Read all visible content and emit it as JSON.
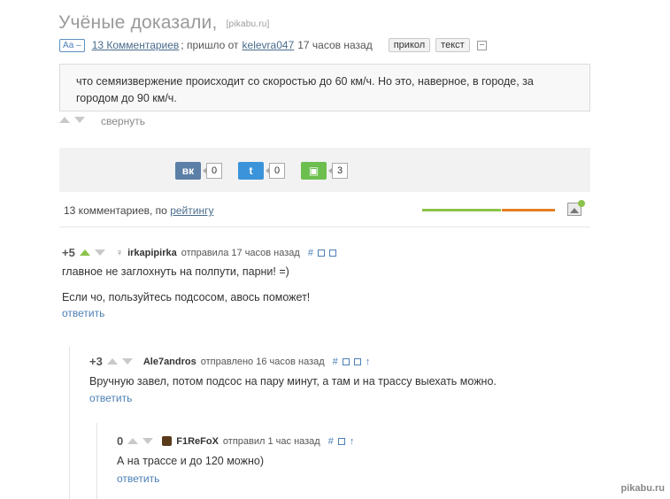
{
  "post": {
    "title": "Учёные доказали,",
    "source": "[pikabu.ru]",
    "font_toggle": "Аа –",
    "comments_link": "13 Комментариев",
    "from_text": "; пришло от",
    "author": "kelevra047",
    "time": "17 часов назад",
    "tags": [
      "прикол",
      "текст"
    ],
    "body": "что семяизвержение происходит со скоростью до 60 км/ч. Но это, наверное, в городе, за городом до 90 км/ч.",
    "collapse_label": "свернуть"
  },
  "share": {
    "vk": {
      "label": "вк",
      "count": "0"
    },
    "twitter": {
      "label": "t",
      "count": "0"
    },
    "save": {
      "label": "▣",
      "count": "3"
    }
  },
  "comments_header": {
    "text": "13 комментариев, по ",
    "sort_link": "рейтингу"
  },
  "comments": [
    {
      "rating": "+5",
      "user": "irkapipirka",
      "sent": "отправила 17 часов назад",
      "text1": "главное не заглохнуть на полпути, парни! =)",
      "text2": "Если чо, пользуйтесь подсосом, авось поможет!",
      "reply": "ответить"
    },
    {
      "rating": "+3",
      "user": "Ale7andros",
      "sent": "отправлено 16 часов назад",
      "text1": "Вручную завел, потом подсос на пару минут, а там и на трассу выехать можно.",
      "reply": "ответить"
    },
    {
      "rating": "0",
      "user": "F1ReFoX",
      "sent": "отправил 1 час назад",
      "text1": "А на трассе и до 120 можно)",
      "reply": "ответить"
    }
  ],
  "watermark": "pikabu.ru",
  "colors": {
    "accent": "#4a7fb5",
    "vk": "#5b7fa6",
    "twitter": "#3b94d9",
    "save": "#6cbf4f",
    "green": "#8bc34a",
    "orange": "#e67e22"
  }
}
